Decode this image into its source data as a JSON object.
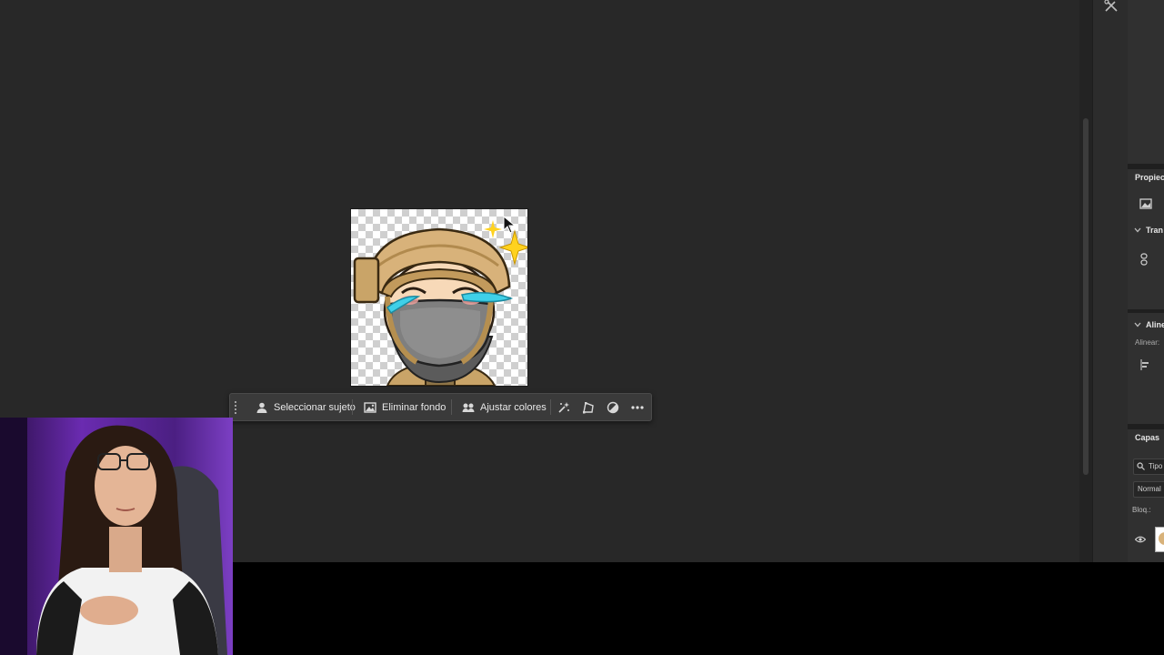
{
  "taskbar": {
    "select_subject": "Seleccionar sujeto",
    "remove_background": "Eliminar fondo",
    "adjust_colors": "Ajustar colores"
  },
  "right_panel": {
    "properties_title": "Propiec",
    "transform_title": "Tran",
    "align_title": "Aline",
    "align_label": "Alinear:",
    "layers_title": "Capas",
    "filter_type": "Tipo",
    "blend_mode": "Normal",
    "lock_label": "Bloq.:"
  },
  "icons": {
    "magic_select": "sparkle-select-icon",
    "transform": "perspective-transform-icon",
    "mask": "half-circle-mask-icon",
    "more": "ellipsis-icon"
  },
  "colors": {
    "workspace": "#282828",
    "taskbar": "#3a3a3a",
    "webcam_purple": "#6a2bb0"
  }
}
